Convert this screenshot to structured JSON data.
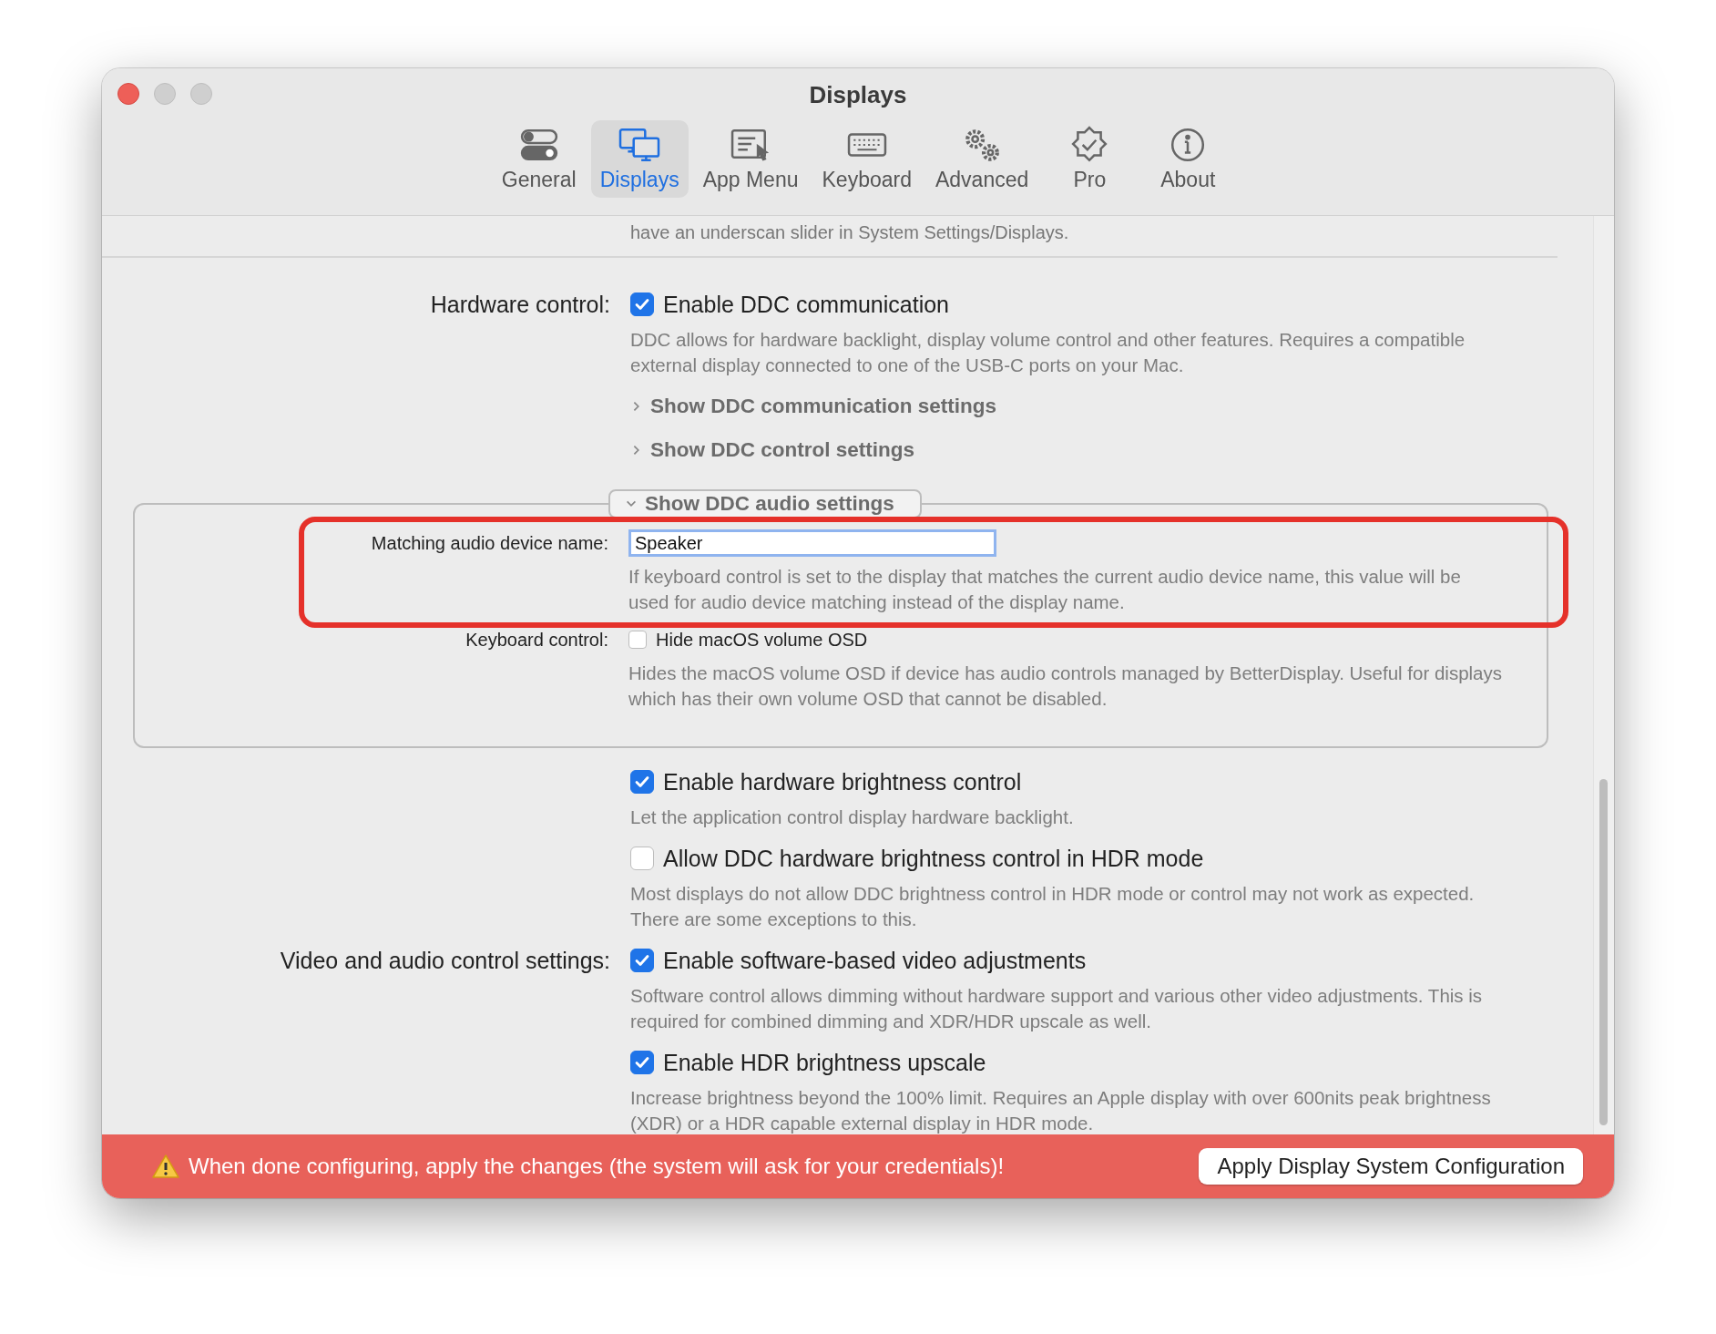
{
  "window": {
    "title": "Displays"
  },
  "toolbar": [
    {
      "label": "General",
      "selected": false
    },
    {
      "label": "Displays",
      "selected": true
    },
    {
      "label": "App Menu",
      "selected": false
    },
    {
      "label": "Keyboard",
      "selected": false
    },
    {
      "label": "Advanced",
      "selected": false
    },
    {
      "label": "Pro",
      "selected": false
    },
    {
      "label": "About",
      "selected": false
    }
  ],
  "top_note": "have an underscan slider in System Settings/Displays.",
  "rows": [
    {
      "kind": "checkbox",
      "row_label": "Hardware control:",
      "label": "Enable DDC communication",
      "checked": true,
      "description": "DDC allows for hardware backlight, display volume control and other features. Requires a compatible external display connected to one of the USB-C ports on your Mac."
    },
    {
      "kind": "disclosure",
      "label": "Show DDC communication settings",
      "expanded": false
    },
    {
      "kind": "disclosure",
      "label": "Show DDC control settings",
      "expanded": false
    },
    {
      "kind": "group",
      "label": "Show DDC audio settings",
      "expanded": true,
      "rows": [
        {
          "kind": "field",
          "row_label": "Matching audio device name:",
          "value": "Speaker",
          "highlighted": true,
          "description": "If keyboard control is set to the display that matches the current audio device name, this value will be used for audio device matching instead of the display name."
        },
        {
          "kind": "checkbox",
          "row_label": "Keyboard control:",
          "label": "Hide macOS volume OSD",
          "checked": false,
          "description": "Hides the macOS volume OSD if device has audio controls managed by BetterDisplay. Useful for displays which has their own volume OSD that cannot be disabled."
        }
      ]
    },
    {
      "kind": "checkbox",
      "label": "Enable hardware brightness control",
      "checked": true,
      "description": "Let the application control display hardware backlight."
    },
    {
      "kind": "checkbox",
      "label": "Allow DDC hardware brightness control in HDR mode",
      "checked": false,
      "description": "Most displays do not allow DDC brightness control in HDR mode or control may not work as expected. There are some exceptions to this."
    },
    {
      "kind": "checkbox",
      "row_label": "Video and audio control settings:",
      "label": "Enable software-based video adjustments",
      "checked": true,
      "description": "Software control allows dimming without hardware support and  various other video adjustments. This is required for combined dimming and XDR/HDR upscale as well."
    },
    {
      "kind": "checkbox",
      "label": "Enable HDR brightness upscale",
      "checked": true,
      "description": "Increase brightness beyond the 100% limit. Requires an Apple display with over 600nits peak brightness (XDR) or a HDR capable external display in HDR mode."
    }
  ],
  "banner": {
    "warning": "When done configuring, apply the changes (the system will ask for your credentials)!",
    "button": "Apply Display System Configuration"
  }
}
